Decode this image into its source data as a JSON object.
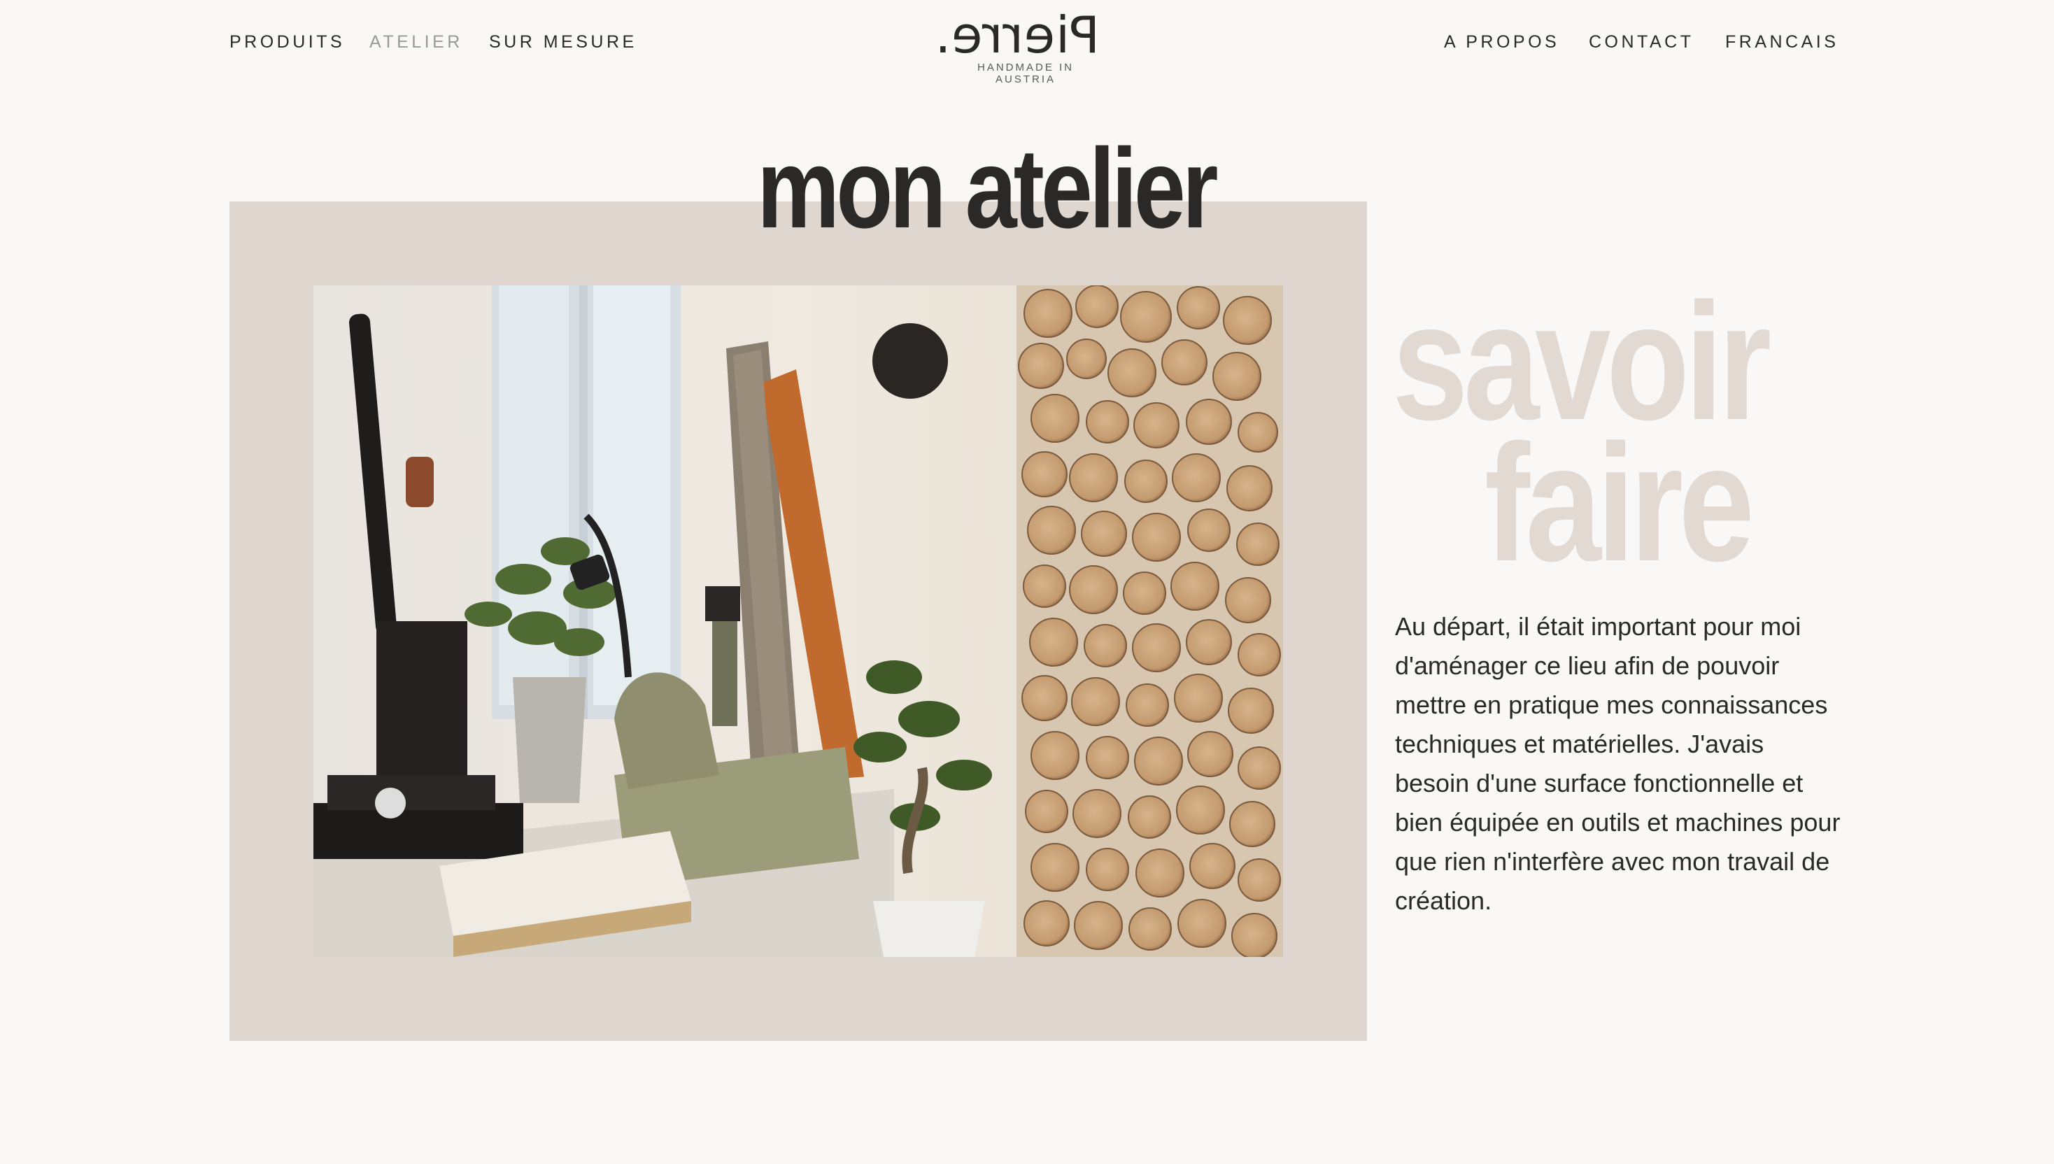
{
  "nav": {
    "left": [
      "PRODUITS",
      "ATELIER",
      "SUR MESURE"
    ],
    "right": [
      "A PROPOS",
      "CONTACT",
      "FRANCAIS"
    ],
    "active": "ATELIER"
  },
  "logo": {
    "mark": "Pierre.",
    "tagline": "HANDMADE IN AUSTRIA"
  },
  "hero": {
    "title": "mon atelier",
    "image_alt": "workshop"
  },
  "aside": {
    "heading_line1": "savoir",
    "heading_line2": "faire",
    "body": "Au départ, il était important pour moi d'aménager ce lieu afin de pouvoir mettre en pratique mes connaissances techniques et matérielles. J'avais besoin d'une surface fonctionnelle et bien équipée en outils et machines pour que rien n'interfère avec mon travail de création."
  },
  "colors": {
    "background": "#f9f8f7",
    "panel": "#ded6cf",
    "text": "#2b2828",
    "muted_heading": "#e1d9d2",
    "nav_active": "#9c9895"
  }
}
